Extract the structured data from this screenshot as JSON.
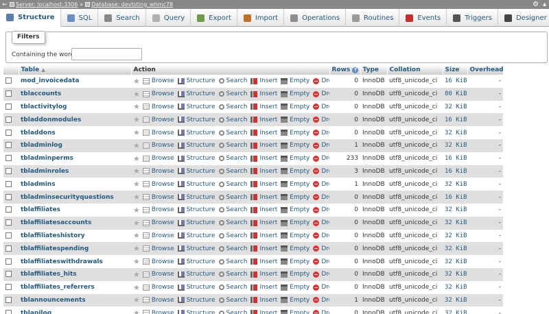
{
  "topbar": {
    "server": "Server: localhost:3306",
    "database": "Database: devtsting_whmc78",
    "separator": "»"
  },
  "tabs": [
    {
      "label": "Structure",
      "icon": "structure-icon",
      "color": "#5a7fae"
    },
    {
      "label": "SQL",
      "icon": "sql-icon",
      "color": "#6b8fc0"
    },
    {
      "label": "Search",
      "icon": "search-icon",
      "color": "#888888"
    },
    {
      "label": "Query",
      "icon": "query-icon",
      "color": "#b0b0b0"
    },
    {
      "label": "Export",
      "icon": "export-icon",
      "color": "#6f9a4a"
    },
    {
      "label": "Import",
      "icon": "import-icon",
      "color": "#c0702a"
    },
    {
      "label": "Operations",
      "icon": "wrench-icon",
      "color": "#8f8f8f"
    },
    {
      "label": "Routines",
      "icon": "routines-icon",
      "color": "#9a9a9a"
    },
    {
      "label": "Events",
      "icon": "clock-icon",
      "color": "#c9302c"
    },
    {
      "label": "Triggers",
      "icon": "triggers-icon",
      "color": "#555555"
    },
    {
      "label": "Designer",
      "icon": "designer-icon",
      "color": "#444444"
    }
  ],
  "filters": {
    "legend": "Filters",
    "label": "Containing the word:",
    "value": ""
  },
  "table": {
    "headers": {
      "table": "Table",
      "action": "Action",
      "rows": "Rows",
      "type": "Type",
      "collation": "Collation",
      "size": "Size",
      "overhead": "Overhead"
    },
    "actions": {
      "browse": "Browse",
      "structure": "Structure",
      "search": "Search",
      "insert": "Insert",
      "empty": "Empty",
      "drop": "Drop"
    },
    "rows": [
      {
        "name": "mod_invoicedata",
        "rows": "0",
        "type": "InnoDB",
        "collation": "utf8_unicode_ci",
        "size": "16 KiB",
        "overhead": "-"
      },
      {
        "name": "tblaccounts",
        "rows": "0",
        "type": "InnoDB",
        "collation": "utf8_unicode_ci",
        "size": "80 KiB",
        "overhead": "-"
      },
      {
        "name": "tblactivitylog",
        "rows": "0",
        "type": "InnoDB",
        "collation": "utf8_unicode_ci",
        "size": "32 KiB",
        "overhead": "-"
      },
      {
        "name": "tbladdonmodules",
        "rows": "0",
        "type": "InnoDB",
        "collation": "utf8_unicode_ci",
        "size": "16 KiB",
        "overhead": "-"
      },
      {
        "name": "tbladdons",
        "rows": "0",
        "type": "InnoDB",
        "collation": "utf8_unicode_ci",
        "size": "32 KiB",
        "overhead": "-"
      },
      {
        "name": "tbladminlog",
        "rows": "1",
        "type": "InnoDB",
        "collation": "utf8_unicode_ci",
        "size": "32 KiB",
        "overhead": "-"
      },
      {
        "name": "tbladminperms",
        "rows": "233",
        "type": "InnoDB",
        "collation": "utf8_unicode_ci",
        "size": "16 KiB",
        "overhead": "-"
      },
      {
        "name": "tbladminroles",
        "rows": "3",
        "type": "InnoDB",
        "collation": "utf8_unicode_ci",
        "size": "16 KiB",
        "overhead": "-"
      },
      {
        "name": "tbladmins",
        "rows": "1",
        "type": "InnoDB",
        "collation": "utf8_unicode_ci",
        "size": "32 KiB",
        "overhead": "-"
      },
      {
        "name": "tbladminsecurityquestions",
        "rows": "0",
        "type": "InnoDB",
        "collation": "utf8_unicode_ci",
        "size": "16 KiB",
        "overhead": "-"
      },
      {
        "name": "tblaffiliates",
        "rows": "0",
        "type": "InnoDB",
        "collation": "utf8_unicode_ci",
        "size": "32 KiB",
        "overhead": "-"
      },
      {
        "name": "tblaffiliatesaccounts",
        "rows": "0",
        "type": "InnoDB",
        "collation": "utf8_unicode_ci",
        "size": "32 KiB",
        "overhead": "-"
      },
      {
        "name": "tblaffiliateshistory",
        "rows": "0",
        "type": "InnoDB",
        "collation": "utf8_unicode_ci",
        "size": "32 KiB",
        "overhead": "-"
      },
      {
        "name": "tblaffiliatespending",
        "rows": "0",
        "type": "InnoDB",
        "collation": "utf8_unicode_ci",
        "size": "32 KiB",
        "overhead": "-"
      },
      {
        "name": "tblaffiliateswithdrawals",
        "rows": "0",
        "type": "InnoDB",
        "collation": "utf8_unicode_ci",
        "size": "32 KiB",
        "overhead": "-"
      },
      {
        "name": "tblaffiliates_hits",
        "rows": "0",
        "type": "InnoDB",
        "collation": "utf8_unicode_ci",
        "size": "32 KiB",
        "overhead": "-"
      },
      {
        "name": "tblaffiliates_referrers",
        "rows": "0",
        "type": "InnoDB",
        "collation": "utf8_unicode_ci",
        "size": "32 KiB",
        "overhead": "-"
      },
      {
        "name": "tblannouncements",
        "rows": "1",
        "type": "InnoDB",
        "collation": "utf8_unicode_ci",
        "size": "32 KiB",
        "overhead": "-"
      },
      {
        "name": "tblapilog",
        "rows": "0",
        "type": "InnoDB",
        "collation": "utf8_unicode_ci",
        "size": "32 KiB",
        "overhead": "-"
      }
    ]
  }
}
